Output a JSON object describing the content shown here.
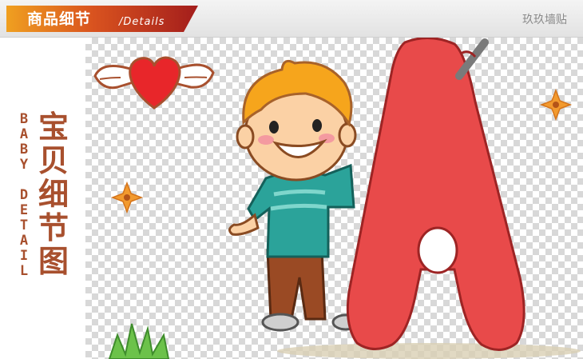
{
  "header": {
    "title": "商品细节",
    "subtitle": "/Details",
    "brand": "玖玖墙贴"
  },
  "side": {
    "title_chars": [
      "宝",
      "贝",
      "细",
      "节",
      "图"
    ],
    "english_chars": [
      "B",
      "A",
      "B",
      "Y",
      "",
      "D",
      "E",
      "T",
      "A",
      "I",
      "L"
    ]
  },
  "colors": {
    "banner_orange": "#f0a020",
    "banner_red": "#b5231e",
    "title_brown": "#a8502e",
    "letter_red": "#e84a4a",
    "shirt_teal": "#2ba39a"
  }
}
